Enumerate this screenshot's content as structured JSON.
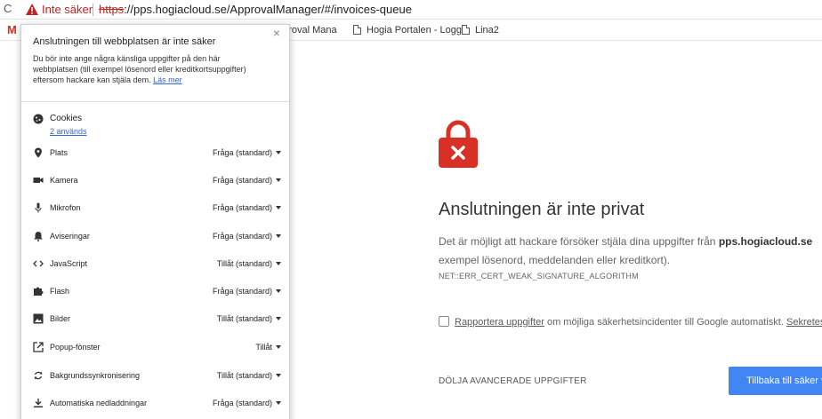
{
  "browser": {
    "security_label": "Inte säker",
    "url_scheme": "https",
    "url_rest": "://pps.hogiacloud.se/ApprovalManager/#/invoices-queue"
  },
  "bookmarks": {
    "gmail_label": "M",
    "items": [
      {
        "label": "pproval Mana"
      },
      {
        "label": "Hogia Portalen - Logg"
      },
      {
        "label": "Lina2"
      }
    ]
  },
  "popup": {
    "title": "Anslutningen till webbplatsen är inte säker",
    "body_line1": "Du bör inte ange några känsliga uppgifter på den här",
    "body_line2": "webbplatsen (till exempel lösenord eller kreditkortsuppgifter)",
    "body_line3": "eftersom hackare kan stjäla dem.",
    "learn_more": "Läs mer",
    "cookies": {
      "label": "Cookies",
      "sub": "2 används"
    },
    "permissions": [
      {
        "label": "Plats",
        "value": "Fråga (standard)",
        "icon": "location-pin-icon"
      },
      {
        "label": "Kamera",
        "value": "Fråga (standard)",
        "icon": "camera-icon"
      },
      {
        "label": "Mikrofon",
        "value": "Fråga (standard)",
        "icon": "microphone-icon"
      },
      {
        "label": "Aviseringar",
        "value": "Fråga (standard)",
        "icon": "bell-icon"
      },
      {
        "label": "JavaScript",
        "value": "Tillåt (standard)",
        "icon": "code-icon"
      },
      {
        "label": "Flash",
        "value": "Fråga (standard)",
        "icon": "puzzle-icon"
      },
      {
        "label": "Bilder",
        "value": "Tillåt (standard)",
        "icon": "image-icon"
      },
      {
        "label": "Popup-fönster",
        "value": "Tillåt",
        "icon": "popup-icon"
      },
      {
        "label": "Bakgrundssynkronisering",
        "value": "Tillåt (standard)",
        "icon": "sync-icon"
      },
      {
        "label": "Automatiska nedladdningar",
        "value": "Fråga (standard)",
        "icon": "download-icon"
      }
    ]
  },
  "error_page": {
    "title": "Anslutningen är inte privat",
    "desc_part1": "Det är möjligt att hackare försöker stjäla dina uppgifter från ",
    "desc_host": "pps.hogiacloud.se",
    "desc_line2": "exempel lösenord, meddelanden eller kreditkort).",
    "error_code": "NET::ERR_CERT_WEAK_SIGNATURE_ALGORITHM",
    "report_link": "Rapportera uppgifter",
    "report_text": " om möjliga säkerhetsincidenter till Google automatiskt. ",
    "report_privacy": "Sekretess",
    "hide_advanced": "DÖLJA AVANCERADE UPPGIFTER",
    "back_button": "Tillbaka till säker v"
  },
  "colors": {
    "accent": "#4285f4",
    "danger": "#c5221f",
    "lock": "#d93025"
  }
}
